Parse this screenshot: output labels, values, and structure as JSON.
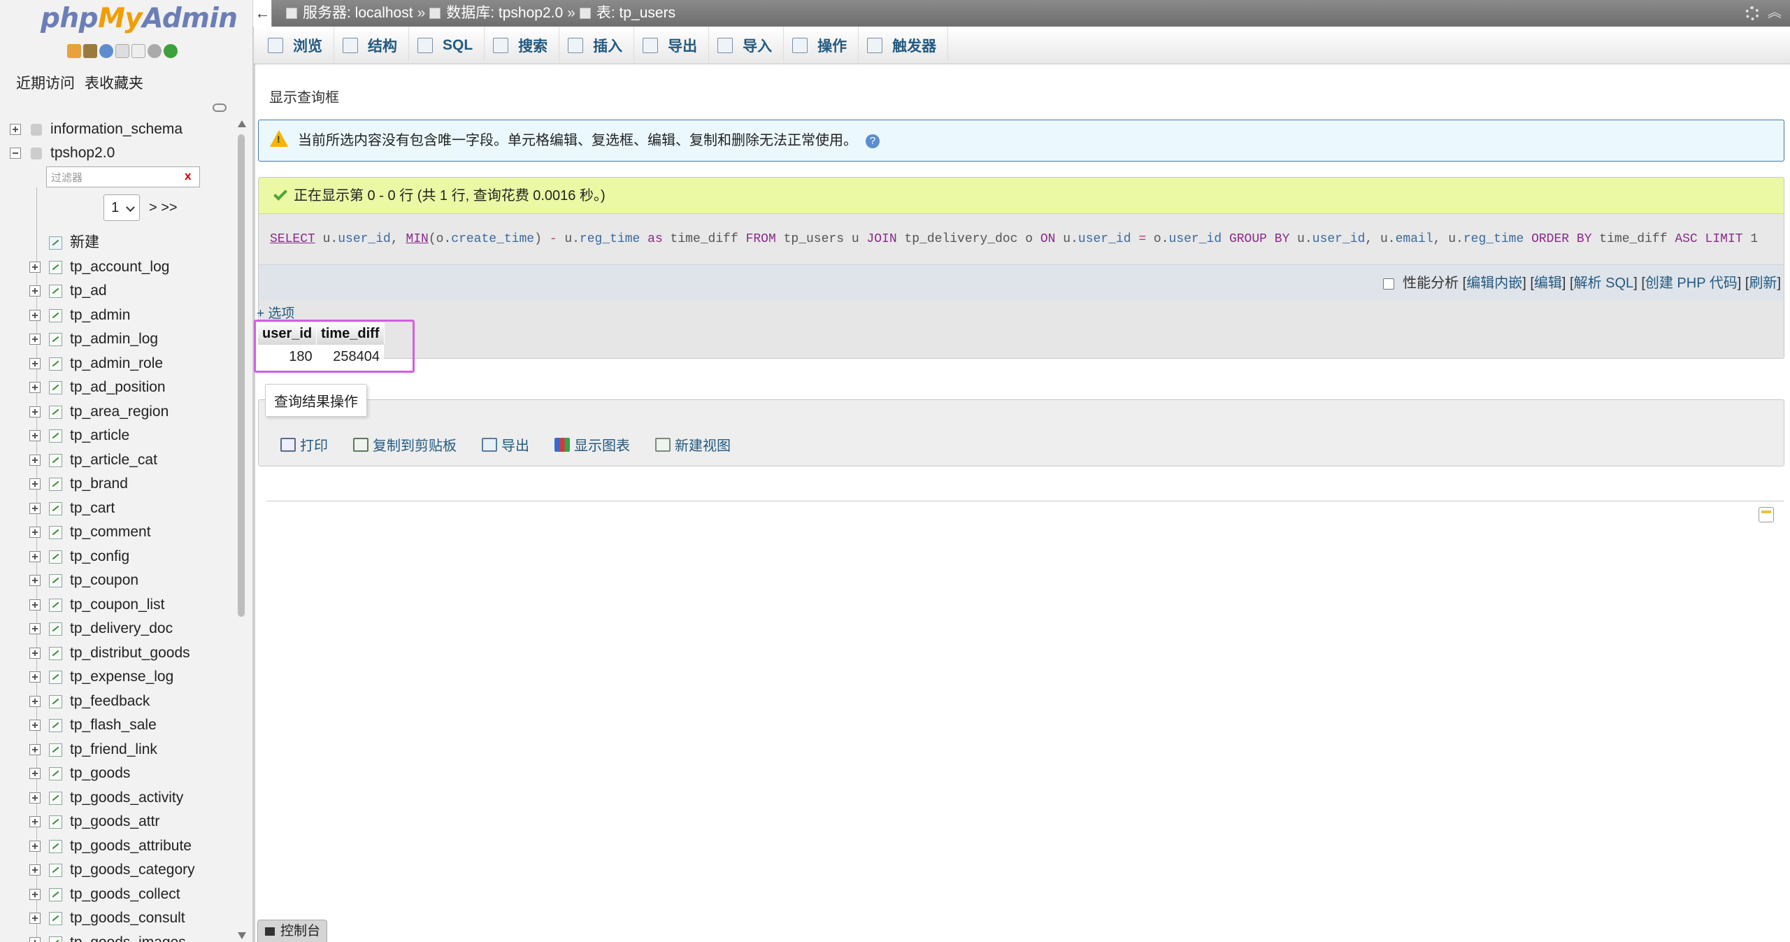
{
  "sidebar": {
    "logo": {
      "php": "php",
      "my": "My",
      "admin": "Admin"
    },
    "logo_icons": [
      "home-icon",
      "exit-icon",
      "help-icon",
      "docs-icon",
      "copy-icon",
      "gear-icon",
      "reload-icon"
    ],
    "tabs": [
      "近期访问",
      "表收藏夹"
    ],
    "databases": [
      {
        "name": "information_schema",
        "expanded": false
      },
      {
        "name": "tpshop2.0",
        "expanded": true
      }
    ],
    "filter_placeholder": "过滤器",
    "filter_clear": "x",
    "page_select": "1",
    "page_next": "> >>",
    "new_label": "新建",
    "tables": [
      "tp_account_log",
      "tp_ad",
      "tp_admin",
      "tp_admin_log",
      "tp_admin_role",
      "tp_ad_position",
      "tp_area_region",
      "tp_article",
      "tp_article_cat",
      "tp_brand",
      "tp_cart",
      "tp_comment",
      "tp_config",
      "tp_coupon",
      "tp_coupon_list",
      "tp_delivery_doc",
      "tp_distribut_goods",
      "tp_expense_log",
      "tp_feedback",
      "tp_flash_sale",
      "tp_friend_link",
      "tp_goods",
      "tp_goods_activity",
      "tp_goods_attr",
      "tp_goods_attribute",
      "tp_goods_category",
      "tp_goods_collect",
      "tp_goods_consult",
      "tp_goods_images"
    ]
  },
  "header": {
    "back": "←",
    "server_label": "服务器: localhost",
    "database_label": "数据库: tpshop2.0",
    "table_label": "表: tp_users",
    "sep": "»"
  },
  "menu": {
    "tabs": [
      "浏览",
      "结构",
      "SQL",
      "搜索",
      "插入",
      "导出",
      "导入",
      "操作",
      "触发器"
    ]
  },
  "main": {
    "show_query": "显示查询框",
    "notice": "当前所选内容没有包含唯一字段。单元格编辑、复选框、编辑、复制和删除无法正常使用。",
    "notice_help": "?",
    "success_message": "正在显示第 0 - 0 行 (共 1 行, 查询花费 0.0016 秒。)",
    "sql": {
      "t1": "SELECT",
      "t2": " u.",
      "t3": "user_id",
      "t4": ", ",
      "t5": "MIN",
      "t6": "(o.",
      "t7": "create_time",
      "t8": ") ",
      "t9": "-",
      "t10": " u.",
      "t11": "reg_time",
      "t12": " as",
      "t13": " time_diff ",
      "t14": "FROM",
      "t15": " tp_users u ",
      "t16": "JOIN",
      "t17": " tp_delivery_doc o ",
      "t18": "ON",
      "t19": " u.",
      "t20": "user_id",
      "t21": " = ",
      "t22": "o.",
      "t23": "user_id",
      "t24": " GROUP BY",
      "t25": " u.",
      "t26": "user_id",
      "t27": ", u.",
      "t28": "email",
      "t29": ", u.",
      "t30": "reg_time",
      "t31": " ORDER BY",
      "t32": " time_diff ",
      "t33": "ASC",
      "t34": " LIMIT",
      "t35": " 1"
    },
    "sql_tools": {
      "profiling": "性能分析",
      "open": "[",
      "close": "]",
      "edit_inline": "编辑内嵌",
      "edit": "编辑",
      "explain": "解析 SQL",
      "php_code": "创建 PHP 代码",
      "refresh": "刷新"
    },
    "options": "+ 选项",
    "result": {
      "columns": [
        "user_id",
        "time_diff"
      ],
      "rows": [
        [
          "180",
          "258404"
        ]
      ]
    },
    "ops_legend": "查询结果操作",
    "ops": [
      "打印",
      "复制到剪贴板",
      "导出",
      "显示图表",
      "新建视图"
    ],
    "console": "控制台"
  },
  "colors": {
    "link": "#235a81",
    "notice_bg": "#ebf8fd",
    "success_bg": "#ebf8a4",
    "highlight": "#d25fe0"
  }
}
